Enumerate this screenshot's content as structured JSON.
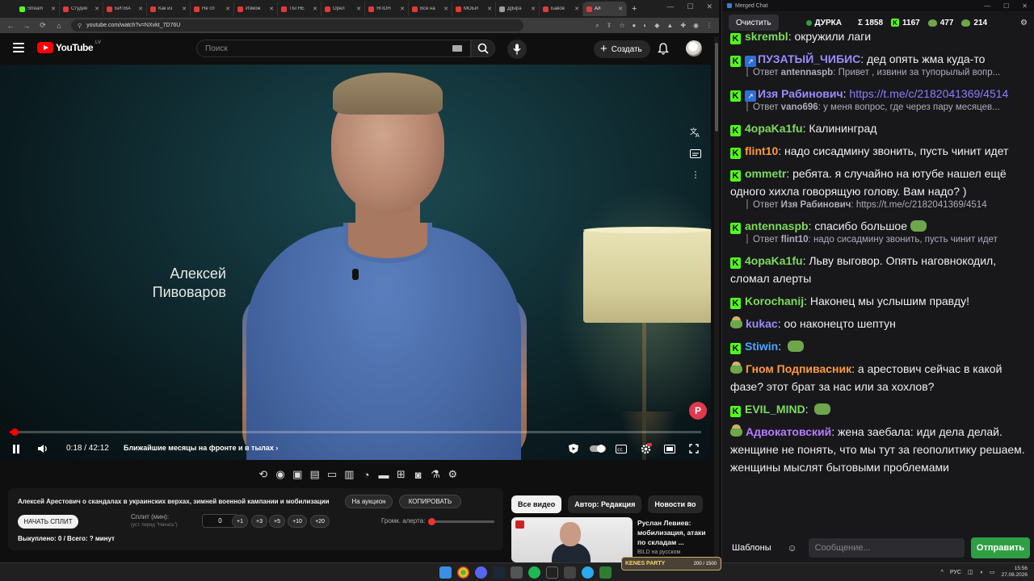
{
  "browser": {
    "tabs": [
      {
        "label": "Stream",
        "color": "#53fc18"
      },
      {
        "label": "Студия",
        "color": "#e53935"
      },
      {
        "label": "БИТВА",
        "color": "#e53935"
      },
      {
        "label": "Как из",
        "color": "#e53935"
      },
      {
        "label": "Не сп",
        "color": "#e53935"
      },
      {
        "label": "Измож",
        "color": "#e53935"
      },
      {
        "label": "ТЫ НЕ",
        "color": "#e53935"
      },
      {
        "label": "Орел",
        "color": "#e53935"
      },
      {
        "label": "ЯПОН",
        "color": "#e53935"
      },
      {
        "label": "Все на",
        "color": "#e53935"
      },
      {
        "label": "МОБИ",
        "color": "#e53935"
      },
      {
        "label": "Д|Ыра",
        "color": "#9e9e9e"
      },
      {
        "label": "Бавов",
        "color": "#e53935"
      },
      {
        "label": "Ал",
        "color": "#e53935",
        "active": true
      }
    ],
    "url": "youtube.com/watch?v=NXvkt_7D76U"
  },
  "youtube": {
    "logo_text": "YouTube",
    "region": "LV",
    "search_placeholder": "Поиск",
    "create_label": "Создать"
  },
  "video": {
    "caption_name": "Алексей Пивоваров",
    "time": "0:18 / 42:12",
    "chapter": "Ближайшие месяцы на фронте и в тылах",
    "progress_fraction": 0.007
  },
  "split": {
    "title": "Алексей Арестович о скандалах в украинских верхах, зимней военной кампании и мобилизации",
    "auction_label": "На аукцион",
    "copy_label": "КОПИРОВАТЬ",
    "start_label": "НАЧАТЬ СПЛИТ",
    "split_label": "Сплит (мин):",
    "split_hint": "(уст. перед \"Начать\")",
    "split_value": "0",
    "steps": [
      "+1",
      "+3",
      "+5",
      "+10",
      "+20"
    ],
    "volume_label": "Громк. алерта:",
    "volume_fraction": 0.03,
    "stats": "Выкуплено: 0 / Всего: ? минут"
  },
  "related": {
    "chips": [
      "Все видео",
      "Автор: Редакция",
      "Новости по"
    ],
    "video_title": "Руслан Левиев: мобилизация, атаки по складам ...",
    "video_channel": "BILD на русском"
  },
  "chat": {
    "window_title": "Merged Chat",
    "clear_label": "Очистить",
    "channel": "ДУРКА",
    "total": "Σ 1858",
    "kick_count": "1167",
    "viewers_a": "477",
    "viewers_b": "214",
    "messages": [
      {
        "user": "skrembl",
        "color": "#7ddc5a",
        "badge": "kick",
        "text": "окружили лаги"
      },
      {
        "user": "ПУЗАТЫЙ_ЧИБИС",
        "color": "#9b8cff",
        "badge": "kick-blue",
        "text": "дед опять жма куда-то",
        "reply_user": "antennaspb",
        "reply_text": "Привет , извини за тупорылый вопр..."
      },
      {
        "user": "Изя Рабинович",
        "color": "#9b8cff",
        "badge": "kick-blue",
        "text": "https://t.me/c/2182041369/4514",
        "link": true,
        "reply_user": "vano696",
        "reply_text": "у меня вопрос, где через пару месяцев..."
      },
      {
        "user": "4opaKa1fu",
        "color": "#7ddc5a",
        "badge": "kick",
        "text": "Калининград"
      },
      {
        "user": "flint10",
        "color": "#ff9a3c",
        "badge": "kick",
        "text": "надо сисадмину звонить, пусть чинит идет"
      },
      {
        "user": "ommetr",
        "color": "#7ddc5a",
        "badge": "kick",
        "text": "ребята. я случайно на ютубе нашел ещё одного хихла говорящую голову. Вам надо? )",
        "reply_user": "Изя Рабинович",
        "reply_text": "https://t.me/c/2182041369/4514"
      },
      {
        "user": "antennaspb",
        "color": "#7ddc5a",
        "badge": "kick",
        "text": "спасибо большое",
        "emote": true,
        "reply_user": "flint10",
        "reply_text": "надо сисадмину звонить, пусть чинит идет"
      },
      {
        "user": "4opaKa1fu",
        "color": "#7ddc5a",
        "badge": "kick",
        "text": "Льву выговор. Опять наговнокодил, сломал алерты"
      },
      {
        "user": "Korochanij",
        "color": "#7ddc5a",
        "badge": "kick",
        "text": "Наконец мы услышим правду!"
      },
      {
        "user": "kukac",
        "color": "#9b8cff",
        "badge": "pepe",
        "text": "оо наконецто шептун"
      },
      {
        "user": "Stiwin",
        "color": "#4aa8ff",
        "badge": "kick",
        "text": "",
        "emote": true
      },
      {
        "user": "Гном Подпивасник",
        "color": "#ff9a3c",
        "badge": "pepe",
        "text": "а арестович сейчас в какой фазе? этот брат за нас или за хохлов?"
      },
      {
        "user": "EVIL_MIND",
        "color": "#7ddc5a",
        "badge": "kick",
        "text": "",
        "emote": true
      },
      {
        "user": "Адвокатовский",
        "color": "#b57bff",
        "badge": "pepe",
        "text": "жена заебала: иди дела делай. женщине не понять, что мы тут за геополитику решаем. женщины мыслят бытовыми проблемами"
      }
    ],
    "templates_label": "Шаблоны",
    "input_placeholder": "Сообщение...",
    "send_label": "Отправить"
  },
  "taskbar": {
    "overlay_brand": "KENES PARTY",
    "overlay_count": "200 / 1500",
    "lang": "РУС",
    "time": "15:56",
    "date": "27.08.2026"
  }
}
